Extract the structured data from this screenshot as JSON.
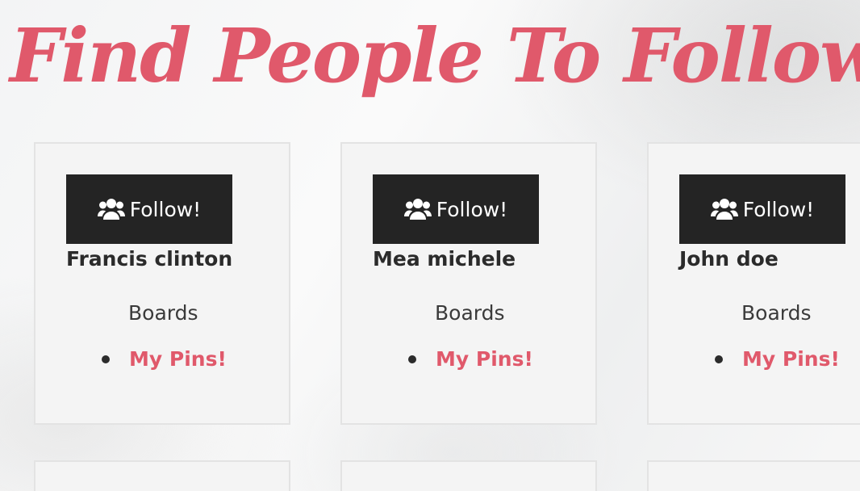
{
  "header": {
    "title": "Find People To Follow"
  },
  "colors": {
    "accent": "#e0596b",
    "button_bg": "#242424",
    "card_bg": "#f4f4f4"
  },
  "cards": [
    {
      "follow_label": "Follow!",
      "follow_icon": "users-icon",
      "name": "Francis clinton",
      "boards_label": "Boards",
      "pins_link": "My Pins!"
    },
    {
      "follow_label": "Follow!",
      "follow_icon": "users-icon",
      "name": "Mea michele",
      "boards_label": "Boards",
      "pins_link": "My Pins!"
    },
    {
      "follow_label": "Follow!",
      "follow_icon": "users-icon",
      "name": "John doe",
      "boards_label": "Boards",
      "pins_link": "My Pins!"
    }
  ]
}
